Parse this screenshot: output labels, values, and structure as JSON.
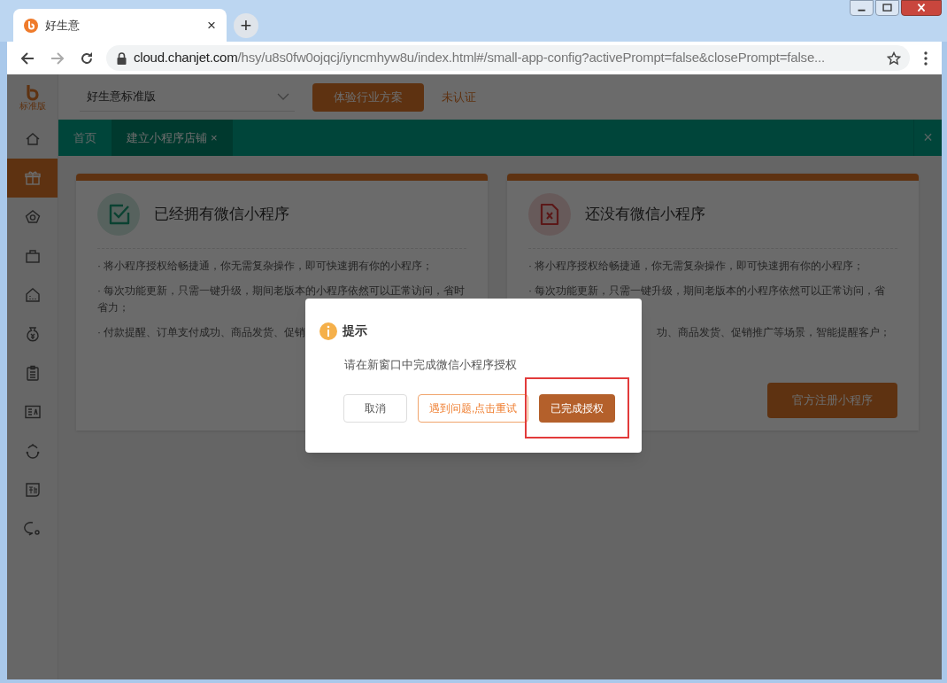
{
  "browser": {
    "tab": {
      "title": "好生意",
      "close": "×"
    },
    "new_tab": "+",
    "url": {
      "host": "cloud.chanjet.com",
      "path": "/hsy/u8s0fw0ojqcj/iyncmhyw8u/index.html#/small-app-config?activePrompt=false&closePrompt=false..."
    }
  },
  "app": {
    "logo": {
      "edition": "标准版"
    },
    "sidebar": {
      "items": [
        {
          "selected": false
        },
        {
          "selected": true
        },
        {
          "selected": false
        },
        {
          "selected": false
        },
        {
          "selected": false
        },
        {
          "selected": false
        },
        {
          "selected": false
        },
        {
          "selected": false
        },
        {
          "selected": false
        },
        {
          "selected": false
        },
        {
          "selected": false
        }
      ]
    },
    "header": {
      "product_select": "好生意标准版",
      "trial_button": "体验行业方案",
      "cert_status": "未认证"
    },
    "tabs": [
      {
        "label": "首页",
        "selected": false
      },
      {
        "label": "建立小程序店铺",
        "selected": true,
        "close": "×"
      }
    ],
    "tabs_close": "×",
    "cards": [
      {
        "kind": "have",
        "title": "已经拥有微信小程序",
        "bullets": [
          {
            "lines": [
              "· 将小程序授权给畅捷通，你无需复杂操作，即可快速拥有你的小程序；"
            ]
          },
          {
            "lines": [
              "· 每次功能更新，只需一键升级，期间老版本的小程序依然可以正常访问，省时",
              "省力；"
            ]
          },
          {
            "lines": [
              "· 付款提醒、订单支付成功、商品发货、促销"
            ]
          }
        ]
      },
      {
        "kind": "none",
        "title": "还没有微信小程序",
        "bullets": [
          {
            "lines": [
              "· 将小程序授权给畅捷通，你无需复杂操作，即可快速拥有你的小程序；"
            ]
          },
          {
            "lines": [
              "· 每次功能更新，只需一键升级，期间老版本的小程序依然可以正常访问，省"
            ]
          },
          {
            "lines": [
              "功、商品发货、促销推广等场景，智能提醒客户；"
            ],
            "starts_hidden": true
          }
        ],
        "button": "官方注册小程序"
      }
    ]
  },
  "dialog": {
    "title": "提示",
    "message": "请在新窗口中完成微信小程序授权",
    "buttons": [
      {
        "kind": "plain",
        "label": "取消"
      },
      {
        "kind": "outline",
        "label": "遇到问题,点击重试"
      },
      {
        "kind": "primary",
        "label": "已完成授权",
        "highlighted": true
      }
    ]
  }
}
